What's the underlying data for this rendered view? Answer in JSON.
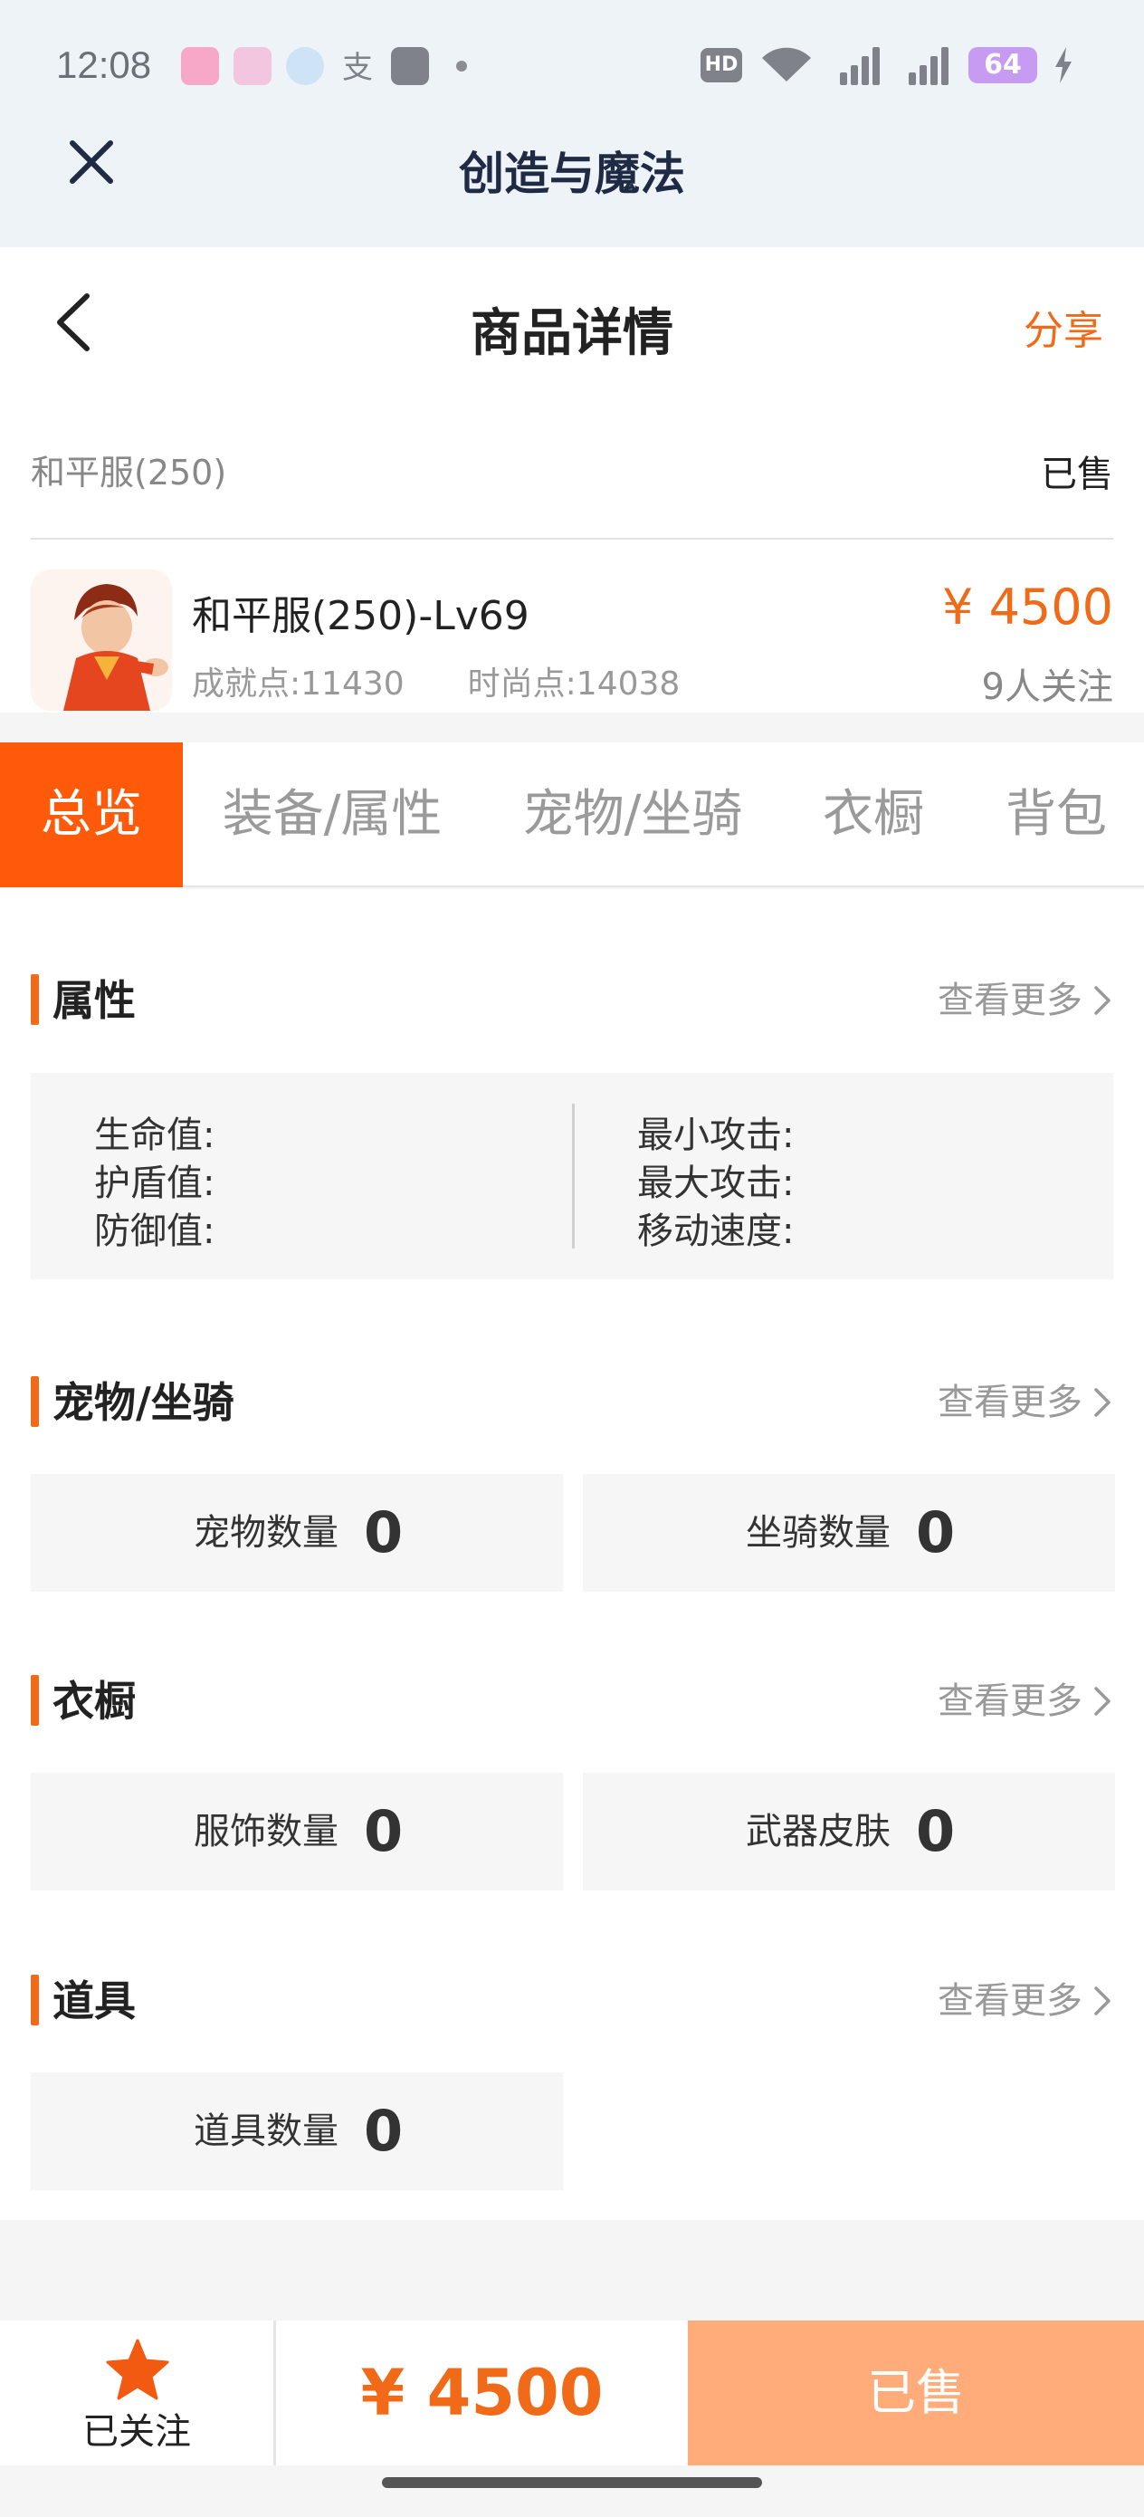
{
  "status_bar": {
    "time": "12:08",
    "hd": "HD",
    "battery": "64"
  },
  "webview": {
    "title": "创造与魔法"
  },
  "header": {
    "title": "商品详情",
    "share": "分享"
  },
  "product": {
    "category": "和平服(250)",
    "status": "已售",
    "name": "和平服(250)-Lv69",
    "achievement": "成就点:11430",
    "fashion": "时尚点:14038",
    "price": "¥ 4500",
    "followers": "9人关注"
  },
  "tabs": [
    "总览",
    "装备/属性",
    "宠物/坐骑",
    "衣橱",
    "背包"
  ],
  "sections": {
    "attributes": {
      "title": "属性",
      "more": "查看更多",
      "left": [
        "生命值:",
        "护盾值:",
        "防御值:"
      ],
      "right": [
        "最小攻击:",
        "最大攻击:",
        "移动速度:"
      ]
    },
    "pets": {
      "title": "宠物/坐骑",
      "more": "查看更多",
      "cards": [
        {
          "label": "宠物数量",
          "value": "0"
        },
        {
          "label": "坐骑数量",
          "value": "0"
        }
      ]
    },
    "wardrobe": {
      "title": "衣橱",
      "more": "查看更多",
      "cards": [
        {
          "label": "服饰数量",
          "value": "0"
        },
        {
          "label": "武器皮肤",
          "value": "0"
        }
      ]
    },
    "items": {
      "title": "道具",
      "more": "查看更多",
      "cards": [
        {
          "label": "道具数量",
          "value": "0"
        }
      ]
    }
  },
  "bottom": {
    "follow_label": "已关注",
    "price": "¥ 4500",
    "sold_label": "已售"
  },
  "colors": {
    "accent": "#f06a17",
    "tab_active": "#ff5a0a",
    "sold_button": "#ffab7a"
  },
  "icons": [
    "close-icon",
    "back-icon",
    "chevron-right-icon",
    "star-icon"
  ]
}
